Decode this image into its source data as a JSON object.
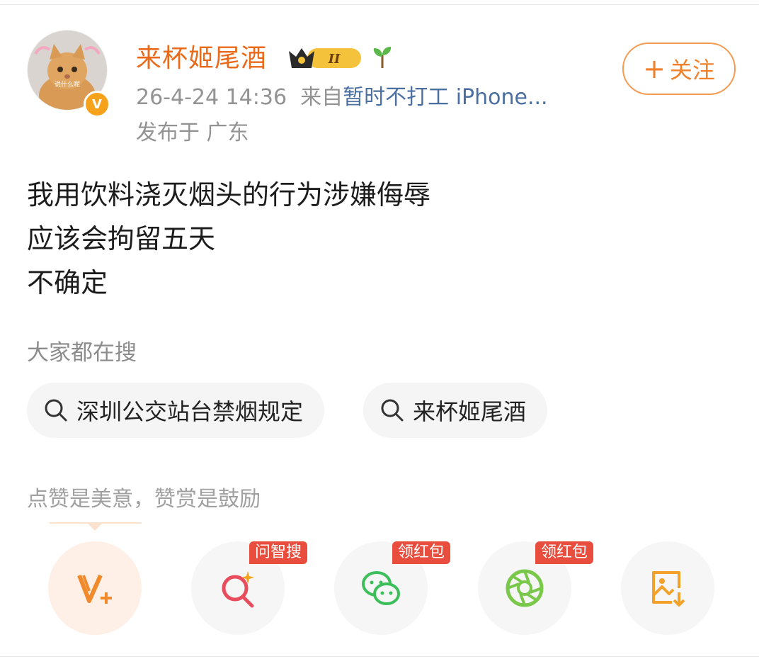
{
  "author": {
    "name": "来杯姬尾酒",
    "avatar_caption": "说什么呢",
    "verified_badge": "V",
    "level_badge": "II",
    "colors": {
      "name": "#e86a1a",
      "badge": "#f6a31b"
    }
  },
  "meta": {
    "timestamp": "26-4-24 14:36",
    "from_prefix": "来自",
    "source": "暂时不打工 iPhone...",
    "location": "发布于 广东"
  },
  "follow": {
    "plus": "+",
    "label": "关注"
  },
  "post": {
    "lines": [
      "我用饮料浇灭烟头的行为涉嫌侮辱",
      "应该会拘留五天",
      "不确定"
    ]
  },
  "search": {
    "heading": "大家都在搜",
    "items": [
      {
        "label": "深圳公交站台禁烟规定",
        "icon": "search-icon"
      },
      {
        "label": "来杯姬尾酒",
        "icon": "search-icon"
      }
    ]
  },
  "reward": {
    "text": "点赞是美意，赞赏是鼓励"
  },
  "actions": [
    {
      "icon": "reward-v-plus-icon",
      "badge": ""
    },
    {
      "icon": "ai-search-icon",
      "badge": "问智搜"
    },
    {
      "icon": "wechat-icon",
      "badge": "领红包"
    },
    {
      "icon": "moments-icon",
      "badge": "领红包"
    },
    {
      "icon": "save-image-icon",
      "badge": ""
    }
  ]
}
